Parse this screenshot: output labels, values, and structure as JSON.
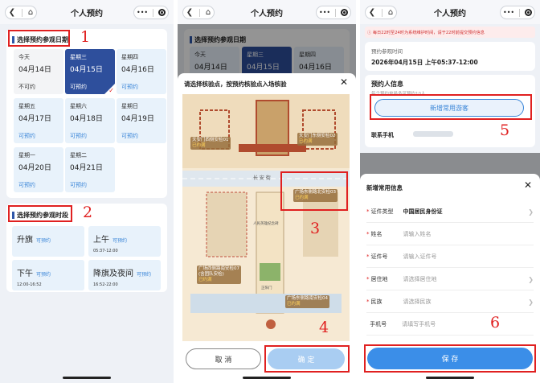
{
  "colors": {
    "brand": "#2e4f9c",
    "accent": "#3b86d8",
    "annotation": "#e02020"
  },
  "nav": {
    "title": "个人预约",
    "back_icon": "chevron-left-icon",
    "home_icon": "home-icon",
    "more": "•••"
  },
  "panel1": {
    "date_section_title": "选择预约参观日期",
    "days": [
      {
        "weekday": "今天",
        "date": "04月14日",
        "status": "不可约",
        "state": "disabled"
      },
      {
        "weekday": "星期三",
        "date": "04月15日",
        "status": "可预约",
        "state": "selected"
      },
      {
        "weekday": "星期四",
        "date": "04月16日",
        "status": "可预约",
        "state": "available"
      },
      {
        "weekday": "星期五",
        "date": "04月17日",
        "status": "可预约",
        "state": "available"
      },
      {
        "weekday": "星期六",
        "date": "04月18日",
        "status": "可预约",
        "state": "available"
      },
      {
        "weekday": "星期日",
        "date": "04月19日",
        "status": "可预约",
        "state": "available"
      },
      {
        "weekday": "星期一",
        "date": "04月20日",
        "status": "可预约",
        "state": "available"
      },
      {
        "weekday": "星期二",
        "date": "04月21日",
        "status": "可预约",
        "state": "available"
      }
    ],
    "time_section_title": "选择预约参观时段",
    "slots": [
      {
        "name": "升旗",
        "avail": "可预约",
        "time": ""
      },
      {
        "name": "上午",
        "avail": "可预约",
        "time": "05:37-12:00"
      },
      {
        "name": "下午",
        "avail": "可预约",
        "time": "12:00-16:52"
      },
      {
        "name": "降旗及夜间",
        "avail": "可预约",
        "time": "16:52-22:00"
      }
    ],
    "annotations": [
      "1",
      "2"
    ]
  },
  "panel2": {
    "section_title": "选择预约参观日期",
    "days": [
      {
        "weekday": "今天",
        "date": "04月14日"
      },
      {
        "weekday": "星期三",
        "date": "04月15日"
      },
      {
        "weekday": "星期四",
        "date": "04月16日"
      }
    ],
    "modal_title": "请选择核验点，按预约核验点入场核验",
    "checkpoints": [
      {
        "name": "天安门西侧安检01",
        "status": "已约满"
      },
      {
        "name": "天安门东侧安检02",
        "status": "已约满"
      },
      {
        "name": "广场东侧路北安检03",
        "status": "已约满"
      },
      {
        "name": "广场东侧路南安检04",
        "status": "已约满"
      },
      {
        "name": "广场西侧路南安检07",
        "sub": "(含团队安检)",
        "status": "已约满"
      }
    ],
    "map_labels": {
      "street": "长 安 街",
      "hall": "人民英雄纪念碑",
      "gate": "正阳门"
    },
    "cancel": "取 消",
    "confirm": "确 定",
    "annotations": [
      "3",
      "4"
    ]
  },
  "panel3": {
    "notice": "每日22时至24时为系统维护时间，请于22时前提交预约信息",
    "visit_time_label": "预约参观时间",
    "visit_time": "2026年04月15日 上午05:37-12:00",
    "person_title": "预约人信息",
    "person_hint": "每个预约单最多可预约10人",
    "add_button": "新增常用游客",
    "phone_label": "联系手机",
    "modal_title": "新增常用信息",
    "fields": [
      {
        "label": "证件类型",
        "value": "中国居民身份证",
        "required": true,
        "chevron": true,
        "filled": true
      },
      {
        "label": "姓名",
        "value": "请输入姓名",
        "required": true,
        "chevron": false,
        "filled": false
      },
      {
        "label": "证件号",
        "value": "请输入证件号",
        "required": true,
        "chevron": false,
        "filled": false
      },
      {
        "label": "居住地",
        "value": "请选择居住地",
        "required": true,
        "chevron": true,
        "filled": false
      },
      {
        "label": "民族",
        "value": "请选择民族",
        "required": true,
        "chevron": true,
        "filled": false
      },
      {
        "label": "手机号",
        "value": "请填写手机号",
        "required": false,
        "chevron": false,
        "filled": false
      }
    ],
    "save": "保 存",
    "annotations": [
      "5",
      "6"
    ]
  }
}
